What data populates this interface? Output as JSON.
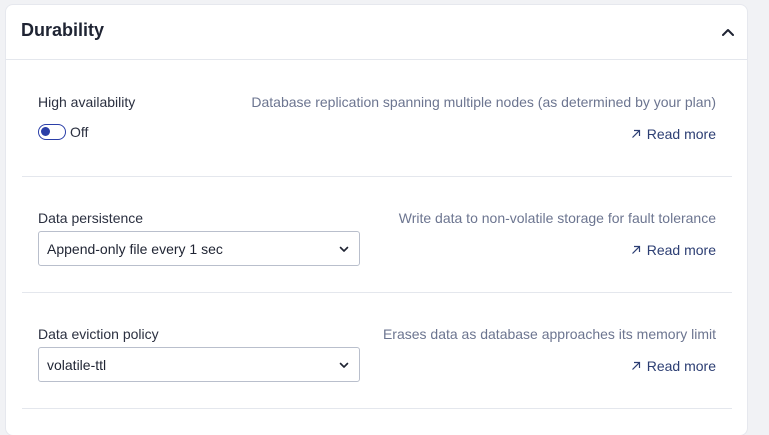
{
  "section": {
    "title": "Durability",
    "collapse_icon": "chevron-up-icon"
  },
  "high_availability": {
    "label": "High availability",
    "description": "Database replication spanning multiple nodes (as determined by your plan)",
    "toggle_state": "Off",
    "read_more": "Read more"
  },
  "data_persistence": {
    "label": "Data persistence",
    "description": "Write data to non-volatile storage for fault tolerance",
    "selected": "Append-only file every 1 sec",
    "read_more": "Read more"
  },
  "eviction_policy": {
    "label": "Data eviction policy",
    "description": "Erases data as database approaches its memory limit",
    "selected": "volatile-ttl",
    "read_more": "Read more"
  },
  "colors": {
    "accent": "#2b3fa8",
    "link": "#2c3e73",
    "muted_text": "#6c7590"
  }
}
